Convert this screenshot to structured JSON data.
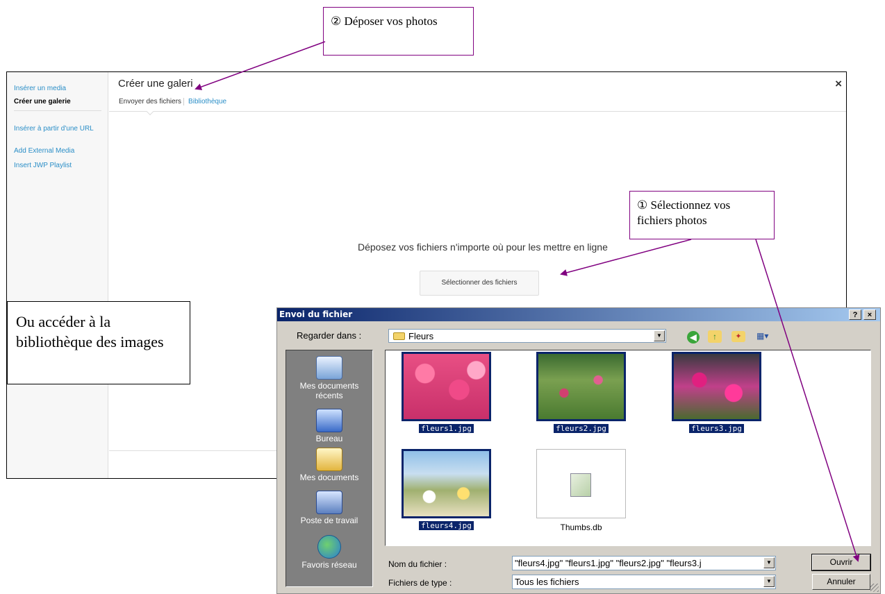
{
  "callouts": {
    "drop": "② Déposer vos photos",
    "select": "① Sélectionnez vos fichiers photos",
    "library": "Ou accéder à la bibliothèque des images"
  },
  "wp_modal": {
    "sidebar": {
      "insert_media": "Insérer un media",
      "create_gallery": "Créer une galerie",
      "insert_url": "Insérer à partir d'une URL",
      "add_external": "Add External Media",
      "insert_jwp": "Insert JWP Playlist"
    },
    "title": "Créer une galeri",
    "close": "×",
    "tabs": {
      "upload": "Envoyer des fichiers",
      "library": "Bibliothèque"
    },
    "drop_text": "Déposez vos fichiers n'importe où pour les mettre en ligne",
    "select_button": "Sélectionner des fichiers"
  },
  "file_dialog": {
    "title": "Envoi du fichier",
    "help": "?",
    "close": "×",
    "look_in_label": "Regarder dans :",
    "look_in_value": "Fleurs",
    "places": {
      "recent": "Mes documents récents",
      "desktop": "Bureau",
      "documents": "Mes documents",
      "computer": "Poste de travail",
      "network": "Favoris réseau"
    },
    "files": [
      {
        "name": "fleurs1.jpg"
      },
      {
        "name": "fleurs2.jpg"
      },
      {
        "name": "fleurs3.jpg"
      },
      {
        "name": "fleurs4.jpg"
      },
      {
        "name": "Thumbs.db"
      }
    ],
    "filename_label": "Nom du fichier :",
    "filename_value": "\"fleurs4.jpg\" \"fleurs1.jpg\" \"fleurs2.jpg\" \"fleurs3.j",
    "filetype_label": "Fichiers de type :",
    "filetype_value": "Tous les fichiers",
    "open_button": "Ouvrir",
    "cancel_button": "Annuler"
  },
  "colors": {
    "accent_purple": "#800080",
    "link_blue": "#2a8ec7",
    "titlebar": "#0a246a"
  }
}
